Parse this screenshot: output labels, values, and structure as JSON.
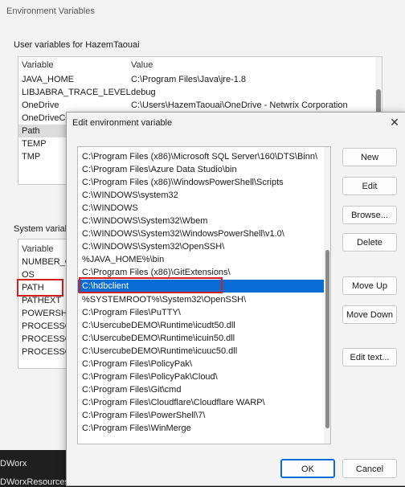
{
  "env_window": {
    "title": "Environment Variables",
    "user_group_label": "User variables for HazemTaouai",
    "user_columns": [
      "Variable",
      "Value"
    ],
    "user_rows": [
      {
        "variable": "JAVA_HOME",
        "value": "C:\\Program Files\\Java\\jre-1.8"
      },
      {
        "variable": "LIBJABRA_TRACE_LEVEL",
        "value": "debug"
      },
      {
        "variable": "OneDrive",
        "value": "C:\\Users\\HazemTaouai\\OneDrive - Netwrix Corporation"
      },
      {
        "variable": "OneDriveCo",
        "value": ""
      },
      {
        "variable": "Path",
        "value": ""
      },
      {
        "variable": "TEMP",
        "value": ""
      },
      {
        "variable": "TMP",
        "value": ""
      }
    ],
    "system_group_label": "System variabl",
    "system_columns": [
      "Variable"
    ],
    "system_rows": [
      {
        "variable": "NUMBER_OF"
      },
      {
        "variable": "OS"
      },
      {
        "variable": "PATH"
      },
      {
        "variable": "PATHEXT"
      },
      {
        "variable": "POWERSHEL"
      },
      {
        "variable": "PROCESSOR"
      },
      {
        "variable": "PROCESSOR"
      },
      {
        "variable": "PROCESSOR"
      }
    ]
  },
  "desktop": {
    "texts": [
      "ld",
      "DWorx",
      "DWorxResources"
    ]
  },
  "dialog": {
    "title": "Edit environment variable",
    "close_icon": "close-icon",
    "entries": [
      "C:\\Program Files (x86)\\Microsoft SQL Server\\160\\DTS\\Binn\\",
      "C:\\Program Files\\Azure Data Studio\\bin",
      "C:\\Program Files (x86)\\WindowsPowerShell\\Scripts",
      "C:\\WINDOWS\\system32",
      "C:\\WINDOWS",
      "C:\\WINDOWS\\System32\\Wbem",
      "C:\\WINDOWS\\System32\\WindowsPowerShell\\v1.0\\",
      "C:\\WINDOWS\\System32\\OpenSSH\\",
      "%JAVA_HOME%\\bin",
      "C:\\Program Files (x86)\\GitExtensions\\",
      "C:\\hdbclient",
      "%SYSTEMROOT%\\System32\\OpenSSH\\",
      "C:\\Program Files\\PuTTY\\",
      "C:\\UsercubeDEMO\\Runtime\\icudt50.dll",
      "C:\\UsercubeDEMO\\Runtime\\icuin50.dll",
      "C:\\UsercubeDEMO\\Runtime\\icuuc50.dll",
      "C:\\Program Files\\PolicyPak\\",
      "C:\\Program Files\\PolicyPak\\Cloud\\",
      "C:\\Program Files\\Git\\cmd",
      "C:\\Program Files\\Cloudflare\\Cloudflare WARP\\",
      "C:\\Program Files\\PowerShell\\7\\",
      "C:\\Program Files\\WinMerge"
    ],
    "selected_entry": "C:\\hdbclient",
    "buttons": {
      "new": "New",
      "edit": "Edit",
      "browse": "Browse...",
      "delete": "Delete",
      "move_up": "Move Up",
      "move_down": "Move Down",
      "edit_text": "Edit text...",
      "ok": "OK",
      "cancel": "Cancel"
    }
  },
  "colors": {
    "selection": "#0a6cd6",
    "highlight_box": "#d02020"
  }
}
